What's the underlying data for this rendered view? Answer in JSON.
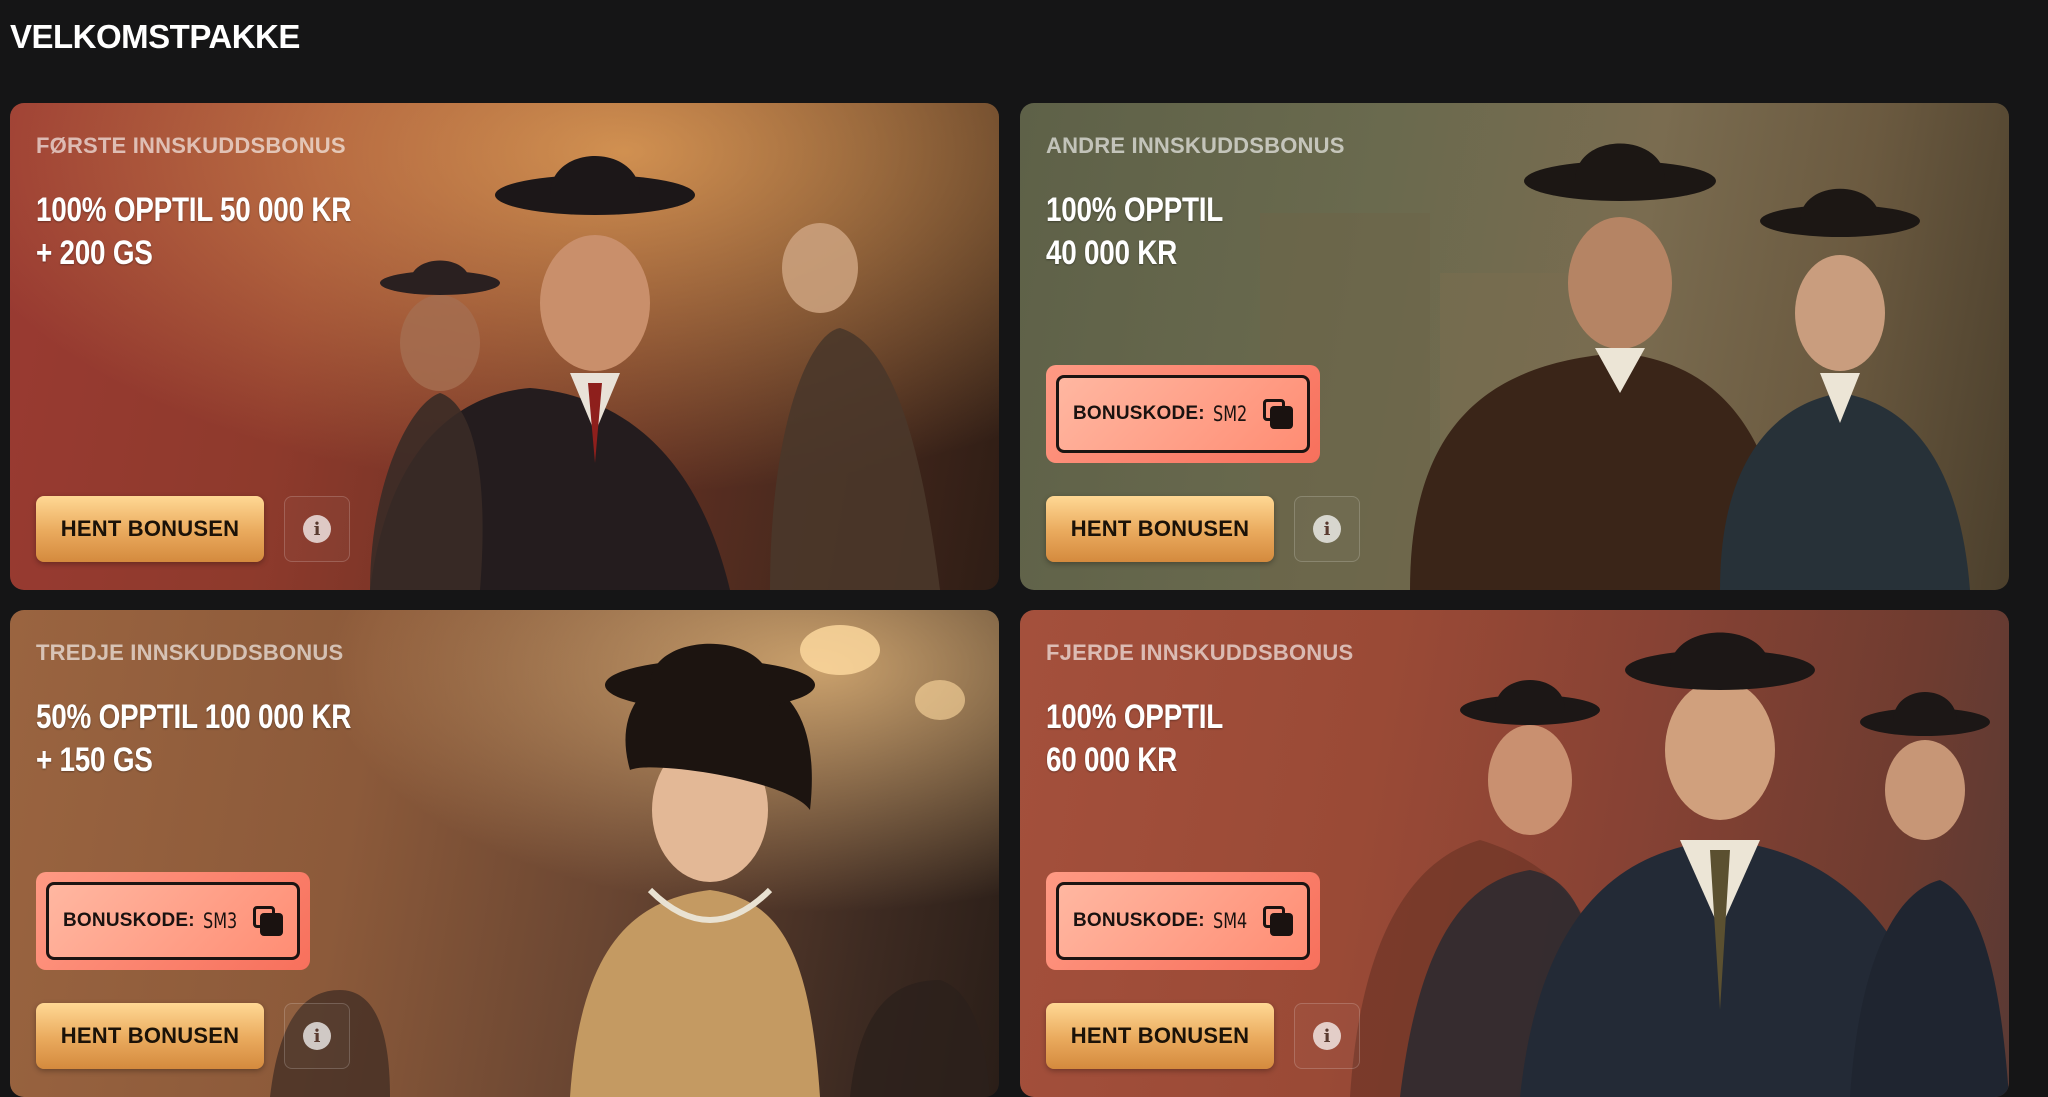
{
  "page": {
    "title": "VELKOMSTPAKKE"
  },
  "colors": {
    "page_background": "#151516",
    "claim_button": "#e9a95c",
    "code_box": "#ff8d74"
  },
  "cards": [
    {
      "label": "FØRSTE INNSKUDDSBONUS",
      "headline": "100% OPPTIL 50 000 KR\n+ 200 GS",
      "bonus_code": null,
      "claim_label": "HENT BONUSEN",
      "info_icon": "info-icon"
    },
    {
      "label": "ANDRE INNSKUDDSBONUS",
      "headline": "100% OPPTIL\n40 000 KR",
      "bonus_code": {
        "label": "BONUSKODE:",
        "value": "SM2",
        "icon": "copy-icon"
      },
      "claim_label": "HENT BONUSEN",
      "info_icon": "info-icon"
    },
    {
      "label": "TREDJE INNSKUDDSBONUS",
      "headline": "50% OPPTIL 100 000 KR\n+ 150 GS",
      "bonus_code": {
        "label": "BONUSKODE:",
        "value": "SM3",
        "icon": "copy-icon"
      },
      "claim_label": "HENT BONUSEN",
      "info_icon": "info-icon"
    },
    {
      "label": "FJERDE INNSKUDDSBONUS",
      "headline": "100% OPPTIL\n60 000 KR",
      "bonus_code": {
        "label": "BONUSKODE:",
        "value": "SM4",
        "icon": "copy-icon"
      },
      "claim_label": "HENT BONUSEN",
      "info_icon": "info-icon"
    }
  ]
}
